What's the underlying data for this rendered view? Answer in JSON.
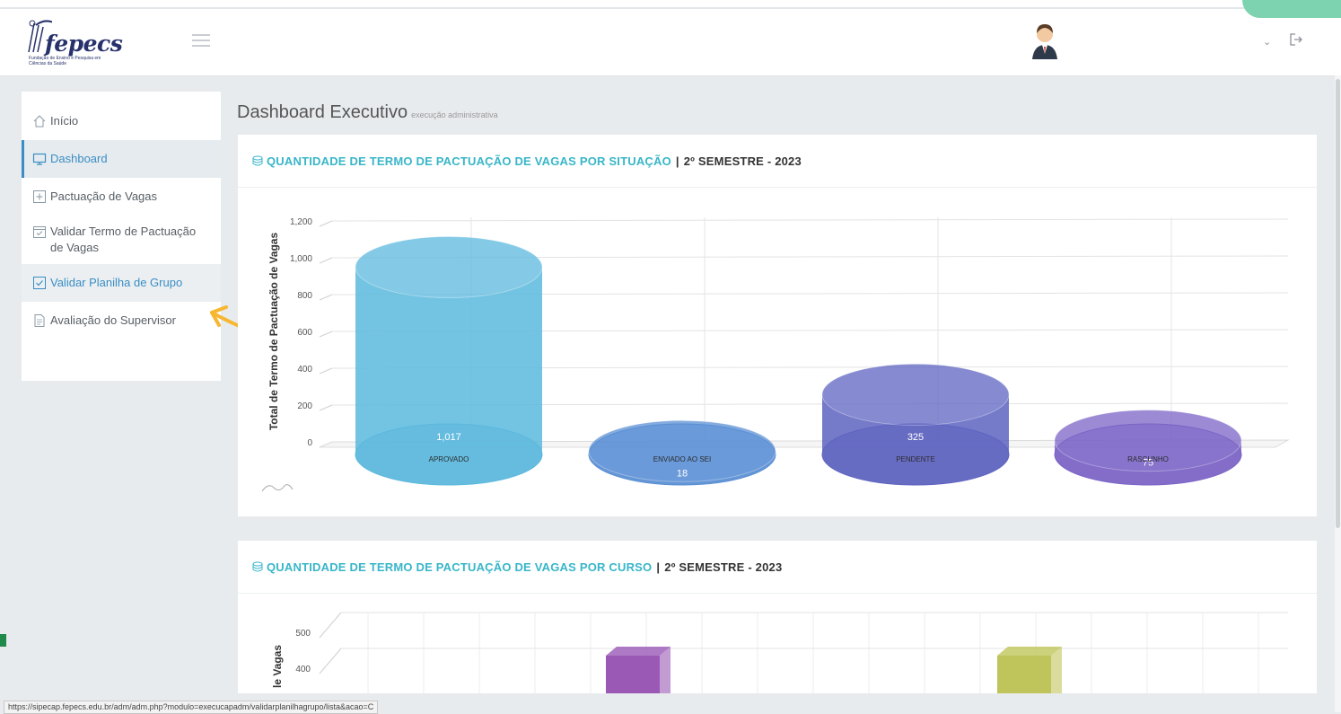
{
  "header": {
    "logo_text": "fepecs",
    "logo_subtext": "Fundação de Ensino e Pesquisa em Ciências da Saúde"
  },
  "sidebar": {
    "items": [
      {
        "label": "Início",
        "icon": "home-icon"
      },
      {
        "label": "Dashboard",
        "icon": "monitor-icon"
      },
      {
        "label": "Pactuação de Vagas",
        "icon": "plus-square-icon"
      },
      {
        "label": "Validar Termo de Pactuação de Vagas",
        "icon": "calendar-check-icon"
      },
      {
        "label": "Validar Planilha de Grupo",
        "icon": "check-square-icon"
      },
      {
        "label": "Avaliação do Supervisor",
        "icon": "document-icon"
      }
    ]
  },
  "page": {
    "title": "Dashboard Executivo",
    "subtitle": "execução administrativa"
  },
  "panels": [
    {
      "title": "QUANTIDADE DE TERMO DE PACTUAÇÃO DE VAGAS POR SITUAÇÃO",
      "separator": "|",
      "period": "2º SEMESTRE - 2023"
    },
    {
      "title": "QUANTIDADE DE TERMO DE PACTUAÇÃO DE VAGAS POR CURSO",
      "separator": "|",
      "period": "2º SEMESTRE - 2023"
    }
  ],
  "chart_data": [
    {
      "type": "bar",
      "shape": "3d-cylinder",
      "ylabel": "Total de Termo de Pactuação de Vagas",
      "ylim": [
        0,
        1200
      ],
      "yticks": [
        "0",
        "200",
        "400",
        "600",
        "800",
        "1,000",
        "1,200"
      ],
      "categories": [
        "APROVADO",
        "ENVIADO AO SEI",
        "PENDENTE",
        "RASCUNHO"
      ],
      "values": [
        1017,
        18,
        325,
        75
      ],
      "value_labels": [
        "1,017",
        "18",
        "325",
        "75"
      ],
      "colors": [
        "#5bb8dd",
        "#5a8fd4",
        "#5d63c0",
        "#7b64c6"
      ],
      "grid": true
    },
    {
      "type": "bar",
      "shape": "3d-box",
      "ylabel": "le Vagas",
      "yticks": [
        "400",
        "500"
      ],
      "note": "chart cropped at bottom of screenshot; only top portion of two bars visible",
      "visible_bar_colors": [
        "#9b59b6",
        "#bfc55a"
      ]
    }
  ],
  "status_bar": {
    "url": "https://sipecap.fepecs.edu.br/adm/adm.php?modulo=execucapadm/validarplanilhagrupo/lista&acao=C"
  }
}
